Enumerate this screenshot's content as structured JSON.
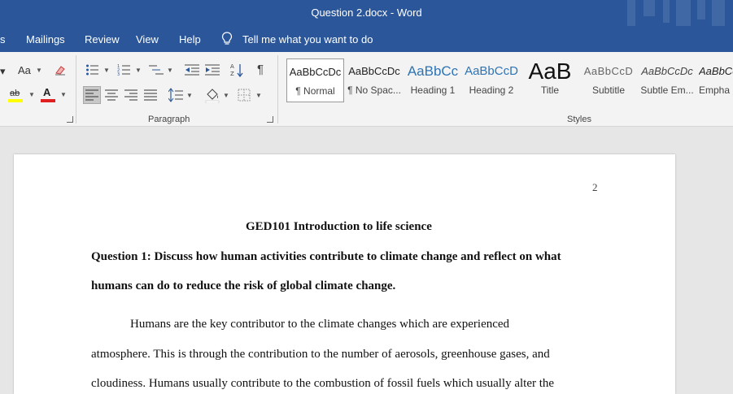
{
  "window": {
    "title": "Question 2.docx  -  Word"
  },
  "menu": {
    "items": [
      "s",
      "Mailings",
      "Review",
      "View",
      "Help"
    ],
    "tell_me": "Tell me what you want to do"
  },
  "ribbon": {
    "font_group": {
      "change_case": "Aa",
      "highlight_label": "ab",
      "font_color_label": "A",
      "highlight_color": "#ffff00",
      "font_color": "#e02020"
    },
    "paragraph_label": "Paragraph",
    "styles_label": "Styles",
    "styles": [
      {
        "preview": "AaBbCcDc",
        "name": "¶ Normal"
      },
      {
        "preview": "AaBbCcDc",
        "name": "¶ No Spac..."
      },
      {
        "preview": "AaBbCc",
        "name": "Heading 1"
      },
      {
        "preview": "AaBbCcD",
        "name": "Heading 2"
      },
      {
        "preview": "AaB",
        "name": "Title"
      },
      {
        "preview": "AaBbCcD",
        "name": "Subtitle"
      },
      {
        "preview": "AaBbCcDc",
        "name": "Subtle Em..."
      },
      {
        "preview": "AaBbCc",
        "name": "Empha"
      }
    ]
  },
  "document": {
    "page_number": "2",
    "title": "GED101 Introduction to life science",
    "question_line1": "Question 1: Discuss how human activities contribute to climate change and reflect on what",
    "question_line2": "humans can do to reduce the risk of global climate change.",
    "body_line1": "Humans are the key contributor to the climate changes which are experienced",
    "body_line2": "atmosphere. This is through the contribution to the number of aerosols, greenhouse gases, and",
    "body_line3": "cloudiness. Humans usually contribute to the combustion of fossil fuels which usually alter the"
  }
}
